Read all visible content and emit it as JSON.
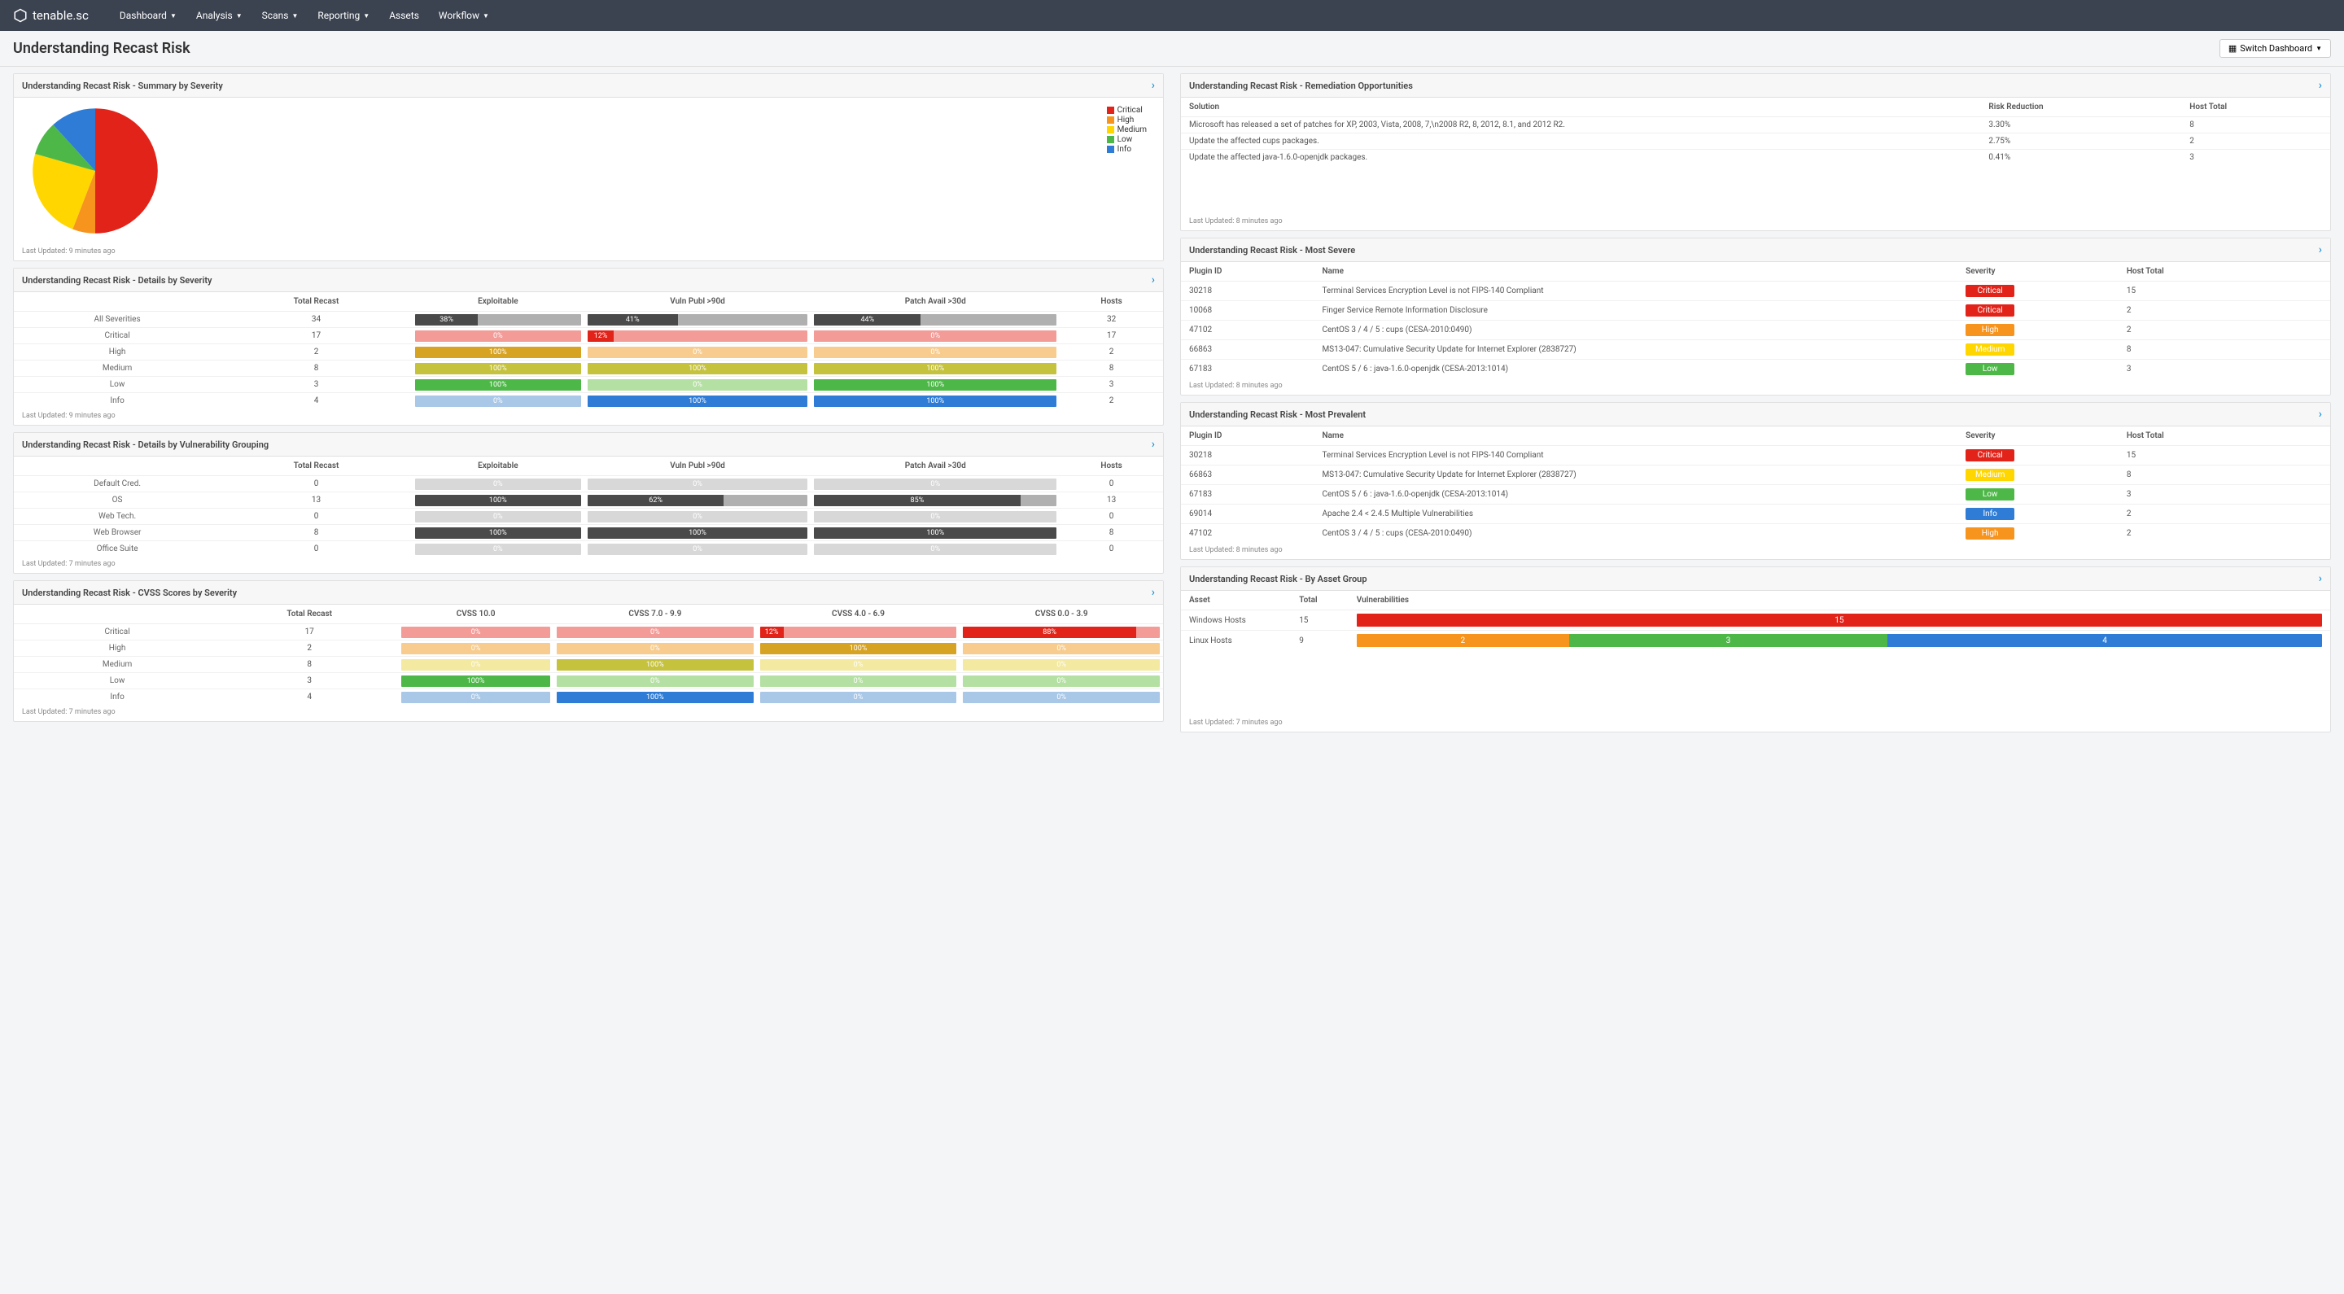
{
  "brand": "tenable.sc",
  "nav": [
    "Dashboard",
    "Analysis",
    "Scans",
    "Reporting",
    "Assets",
    "Workflow"
  ],
  "nav_dropdown": [
    true,
    true,
    true,
    true,
    false,
    true
  ],
  "page_title": "Understanding Recast Risk",
  "switch_label": "Switch Dashboard",
  "colors": {
    "critical": "#e2231a",
    "high": "#f7941e",
    "medium": "#ffd600",
    "low": "#4db848",
    "info": "#2e7cd6",
    "dark": "#4a4a4a",
    "gray": "#b0b0b0",
    "lightgray": "#d8d8d8",
    "crit_light": "#f29b97",
    "high_light": "#f7cc8e",
    "med_light": "#f3e9a1",
    "low_light": "#b5e0a3",
    "info_light": "#a9c7e6",
    "high_dark": "#d7a323",
    "med_dark": "#c5c23e"
  },
  "panels": {
    "summary": {
      "title": "Understanding Recast Risk - Summary by Severity",
      "footer": "Last Updated: 9 minutes ago"
    },
    "details_sev": {
      "title": "Understanding Recast Risk - Details by Severity",
      "footer": "Last Updated: 9 minutes ago",
      "headers": [
        "",
        "Total Recast",
        "Exploitable",
        "Vuln Publ >90d",
        "Patch Avail >30d",
        "Hosts"
      ],
      "rows": [
        {
          "label": "All Severities",
          "total": "34",
          "exp": {
            "v": 38,
            "c": "dark",
            "r": "gray"
          },
          "vuln": {
            "v": 41,
            "c": "dark",
            "r": "gray"
          },
          "patch": {
            "v": 44,
            "c": "dark",
            "r": "gray"
          },
          "hosts": "32"
        },
        {
          "label": "Critical",
          "total": "17",
          "exp": {
            "v": 0,
            "c": "crit_light",
            "r": "crit_light"
          },
          "vuln": {
            "v": 12,
            "c": "critical",
            "r": "crit_light"
          },
          "patch": {
            "v": 0,
            "c": "crit_light",
            "r": "crit_light"
          },
          "hosts": "17"
        },
        {
          "label": "High",
          "total": "2",
          "exp": {
            "v": 100,
            "c": "high_dark",
            "r": "high_light"
          },
          "vuln": {
            "v": 0,
            "c": "high_light",
            "r": "high_light"
          },
          "patch": {
            "v": 0,
            "c": "high_light",
            "r": "high_light"
          },
          "hosts": "2"
        },
        {
          "label": "Medium",
          "total": "8",
          "exp": {
            "v": 100,
            "c": "med_dark",
            "r": "med_light"
          },
          "vuln": {
            "v": 100,
            "c": "med_dark",
            "r": "med_light"
          },
          "patch": {
            "v": 100,
            "c": "med_dark",
            "r": "med_light"
          },
          "hosts": "8"
        },
        {
          "label": "Low",
          "total": "3",
          "exp": {
            "v": 100,
            "c": "low",
            "r": "low_light"
          },
          "vuln": {
            "v": 0,
            "c": "low_light",
            "r": "low_light"
          },
          "patch": {
            "v": 100,
            "c": "low",
            "r": "low_light"
          },
          "hosts": "3"
        },
        {
          "label": "Info",
          "total": "4",
          "exp": {
            "v": 0,
            "c": "info_light",
            "r": "info_light"
          },
          "vuln": {
            "v": 100,
            "c": "info",
            "r": "info_light"
          },
          "patch": {
            "v": 100,
            "c": "info",
            "r": "info_light"
          },
          "hosts": "2"
        }
      ]
    },
    "details_group": {
      "title": "Understanding Recast Risk - Details by Vulnerability Grouping",
      "footer": "Last Updated: 7 minutes ago",
      "headers": [
        "",
        "Total Recast",
        "Exploitable",
        "Vuln Publ >90d",
        "Patch Avail >30d",
        "Hosts"
      ],
      "rows": [
        {
          "label": "Default Cred.",
          "total": "0",
          "exp": {
            "v": 0,
            "c": "gray",
            "r": "lightgray"
          },
          "vuln": {
            "v": 0,
            "c": "gray",
            "r": "lightgray"
          },
          "patch": {
            "v": 0,
            "c": "gray",
            "r": "lightgray"
          },
          "hosts": "0"
        },
        {
          "label": "OS",
          "total": "13",
          "exp": {
            "v": 100,
            "c": "dark",
            "r": "gray"
          },
          "vuln": {
            "v": 62,
            "c": "dark",
            "r": "gray"
          },
          "patch": {
            "v": 85,
            "c": "dark",
            "r": "gray"
          },
          "hosts": "13"
        },
        {
          "label": "Web Tech.",
          "total": "0",
          "exp": {
            "v": 0,
            "c": "gray",
            "r": "lightgray"
          },
          "vuln": {
            "v": 0,
            "c": "gray",
            "r": "lightgray"
          },
          "patch": {
            "v": 0,
            "c": "gray",
            "r": "lightgray"
          },
          "hosts": "0"
        },
        {
          "label": "Web Browser",
          "total": "8",
          "exp": {
            "v": 100,
            "c": "dark",
            "r": "gray"
          },
          "vuln": {
            "v": 100,
            "c": "dark",
            "r": "gray"
          },
          "patch": {
            "v": 100,
            "c": "dark",
            "r": "gray"
          },
          "hosts": "8"
        },
        {
          "label": "Office Suite",
          "total": "0",
          "exp": {
            "v": 0,
            "c": "gray",
            "r": "lightgray"
          },
          "vuln": {
            "v": 0,
            "c": "gray",
            "r": "lightgray"
          },
          "patch": {
            "v": 0,
            "c": "gray",
            "r": "lightgray"
          },
          "hosts": "0"
        }
      ]
    },
    "cvss": {
      "title": "Understanding Recast Risk - CVSS Scores by Severity",
      "footer": "Last Updated: 7 minutes ago",
      "headers": [
        "",
        "Total Recast",
        "CVSS 10.0",
        "CVSS 7.0 - 9.9",
        "CVSS 4.0 - 6.9",
        "CVSS 0.0 - 3.9"
      ],
      "rows": [
        {
          "label": "Critical",
          "total": "17",
          "c1": {
            "v": 0,
            "c": "crit_light",
            "r": "crit_light"
          },
          "c2": {
            "v": 0,
            "c": "crit_light",
            "r": "crit_light"
          },
          "c3": {
            "v": 12,
            "c": "critical",
            "r": "crit_light"
          },
          "c4": {
            "v": 88,
            "c": "critical",
            "r": "crit_light"
          }
        },
        {
          "label": "High",
          "total": "2",
          "c1": {
            "v": 0,
            "c": "high_light",
            "r": "high_light"
          },
          "c2": {
            "v": 0,
            "c": "high_light",
            "r": "high_light"
          },
          "c3": {
            "v": 100,
            "c": "high_dark",
            "r": "high_light"
          },
          "c4": {
            "v": 0,
            "c": "high_light",
            "r": "high_light"
          }
        },
        {
          "label": "Medium",
          "total": "8",
          "c1": {
            "v": 0,
            "c": "med_light",
            "r": "med_light"
          },
          "c2": {
            "v": 100,
            "c": "med_dark",
            "r": "med_light"
          },
          "c3": {
            "v": 0,
            "c": "med_light",
            "r": "med_light"
          },
          "c4": {
            "v": 0,
            "c": "med_light",
            "r": "med_light"
          }
        },
        {
          "label": "Low",
          "total": "3",
          "c1": {
            "v": 100,
            "c": "low",
            "r": "low_light"
          },
          "c2": {
            "v": 0,
            "c": "low_light",
            "r": "low_light"
          },
          "c3": {
            "v": 0,
            "c": "low_light",
            "r": "low_light"
          },
          "c4": {
            "v": 0,
            "c": "low_light",
            "r": "low_light"
          }
        },
        {
          "label": "Info",
          "total": "4",
          "c1": {
            "v": 0,
            "c": "info_light",
            "r": "info_light"
          },
          "c2": {
            "v": 100,
            "c": "info",
            "r": "info_light"
          },
          "c3": {
            "v": 0,
            "c": "info_light",
            "r": "info_light"
          },
          "c4": {
            "v": 0,
            "c": "info_light",
            "r": "info_light"
          }
        }
      ]
    },
    "remediation": {
      "title": "Understanding Recast Risk - Remediation Opportunities",
      "footer": "Last Updated: 8 minutes ago",
      "headers": [
        "Solution",
        "Risk Reduction",
        "Host Total"
      ],
      "rows": [
        {
          "sol": "Microsoft has released a set of patches for XP, 2003, Vista, 2008, 7,\\n2008 R2, 8, 2012, 8.1, and 2012 R2.",
          "risk": "3.30%",
          "hosts": "8"
        },
        {
          "sol": "Update the affected cups packages.",
          "risk": "2.75%",
          "hosts": "2"
        },
        {
          "sol": "Update the affected java-1.6.0-openjdk packages.",
          "risk": "0.41%",
          "hosts": "3"
        }
      ]
    },
    "most_severe": {
      "title": "Understanding Recast Risk - Most Severe",
      "footer": "Last Updated: 8 minutes ago",
      "headers": [
        "Plugin ID",
        "Name",
        "Severity",
        "Host Total"
      ],
      "rows": [
        {
          "id": "30218",
          "name": "Terminal Services Encryption Level is not FIPS-140 Compliant",
          "sev": "Critical",
          "sevc": "critical",
          "hosts": "15"
        },
        {
          "id": "10068",
          "name": "Finger Service Remote Information Disclosure",
          "sev": "Critical",
          "sevc": "critical",
          "hosts": "2"
        },
        {
          "id": "47102",
          "name": "CentOS 3 / 4 / 5 : cups (CESA-2010:0490)",
          "sev": "High",
          "sevc": "high",
          "hosts": "2"
        },
        {
          "id": "66863",
          "name": "MS13-047: Cumulative Security Update for Internet Explorer (2838727)",
          "sev": "Medium",
          "sevc": "medium",
          "hosts": "8"
        },
        {
          "id": "67183",
          "name": "CentOS 5 / 6 : java-1.6.0-openjdk (CESA-2013:1014)",
          "sev": "Low",
          "sevc": "low",
          "hosts": "3"
        }
      ]
    },
    "most_prevalent": {
      "title": "Understanding Recast Risk - Most Prevalent",
      "footer": "Last Updated: 8 minutes ago",
      "headers": [
        "Plugin ID",
        "Name",
        "Severity",
        "Host Total"
      ],
      "rows": [
        {
          "id": "30218",
          "name": "Terminal Services Encryption Level is not FIPS-140 Compliant",
          "sev": "Critical",
          "sevc": "critical",
          "hosts": "15"
        },
        {
          "id": "66863",
          "name": "MS13-047: Cumulative Security Update for Internet Explorer (2838727)",
          "sev": "Medium",
          "sevc": "medium",
          "hosts": "8"
        },
        {
          "id": "67183",
          "name": "CentOS 5 / 6 : java-1.6.0-openjdk (CESA-2013:1014)",
          "sev": "Low",
          "sevc": "low",
          "hosts": "3"
        },
        {
          "id": "69014",
          "name": "Apache 2.4 < 2.4.5 Multiple Vulnerabilities",
          "sev": "Info",
          "sevc": "info",
          "hosts": "2"
        },
        {
          "id": "47102",
          "name": "CentOS 3 / 4 / 5 : cups (CESA-2010:0490)",
          "sev": "High",
          "sevc": "high",
          "hosts": "2"
        }
      ]
    },
    "asset_group": {
      "title": "Understanding Recast Risk - By Asset Group",
      "footer": "Last Updated: 7 minutes ago",
      "headers": [
        "Asset",
        "Total",
        "Vulnerabilities"
      ],
      "rows": [
        {
          "asset": "Windows Hosts",
          "total": "15",
          "segs": [
            {
              "v": 15,
              "c": "critical",
              "w": 100
            }
          ]
        },
        {
          "asset": "Linux Hosts",
          "total": "9",
          "segs": [
            {
              "v": 2,
              "c": "high",
              "w": 22
            },
            {
              "v": 3,
              "c": "low",
              "w": 33
            },
            {
              "v": 4,
              "c": "info",
              "w": 45
            }
          ]
        }
      ]
    }
  },
  "chart_data": {
    "type": "pie",
    "title": "Understanding Recast Risk - Summary by Severity",
    "series": [
      {
        "name": "Critical",
        "value": 17,
        "color": "#e2231a"
      },
      {
        "name": "High",
        "value": 2,
        "color": "#f7941e"
      },
      {
        "name": "Medium",
        "value": 8,
        "color": "#ffd600"
      },
      {
        "name": "Low",
        "value": 3,
        "color": "#4db848"
      },
      {
        "name": "Info",
        "value": 4,
        "color": "#2e7cd6"
      }
    ],
    "legend": [
      "Critical",
      "High",
      "Medium",
      "Low",
      "Info"
    ]
  }
}
